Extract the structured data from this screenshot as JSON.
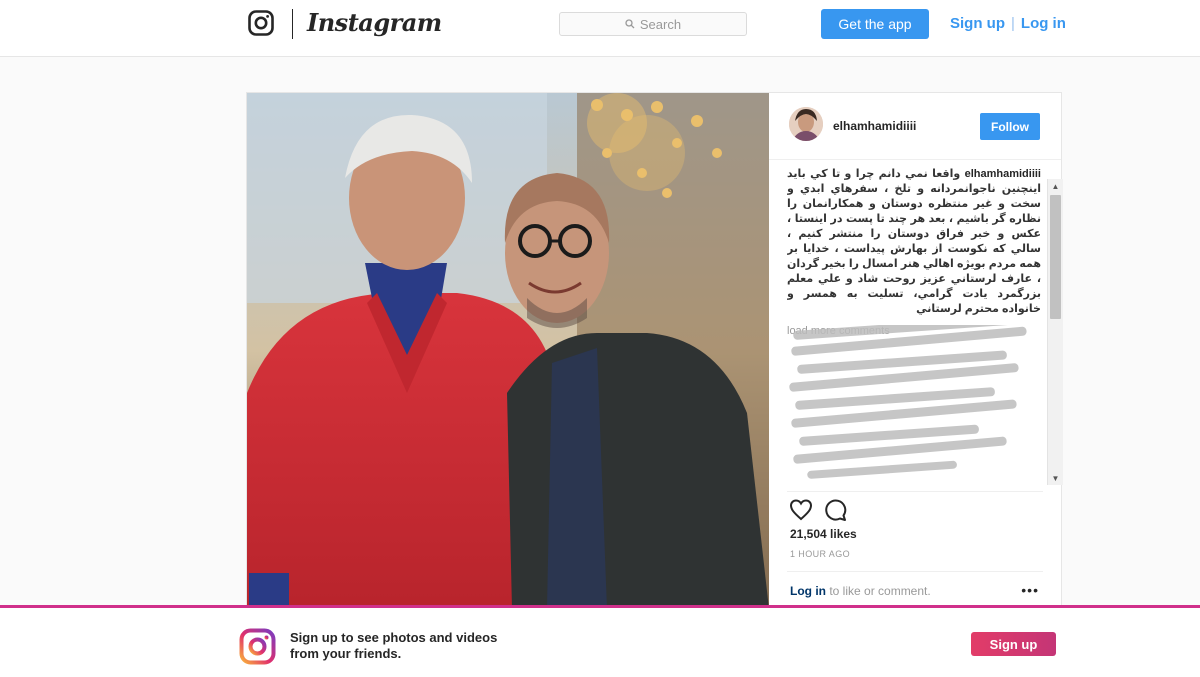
{
  "nav": {
    "wordmark": "Instagram",
    "search_placeholder": "Search",
    "get_app_label": "Get the app",
    "signup_label": "Sign up",
    "separator": "|",
    "login_label": "Log in",
    "accent_color": "#3897f0"
  },
  "post": {
    "username": "elhamhamidiiii",
    "follow_label": "Follow",
    "caption_user": "elhamhamidiiii",
    "caption_text": "واقعا نمي دانم چرا و تا كي بايد اينچنين ناجوانمردانه و تلخ ، سفرهاي ابدي و سخت و غير منتظره دوستان و همكارانمان را نظاره گر باشيم ، بعد هر چند تا پست در اينستا ، عكس و خبر فراق دوستان را منتشر كنيم ، سالي كه نكوست از بهارش پيداست ، خدايا بر همه مردم بويژه اهالي هنر امسال را بخير گردان ، عارف لرستاني عزيز روحت شاد و علي معلم بزرگمرد يادت گرامي، تسليت به همسر و خانواده محترم لرستاني",
    "load_more": "load more comments",
    "likes": "21,504 likes",
    "time": "1 HOUR AGO",
    "login_link": "Log in",
    "login_suffix": " to like or comment.",
    "more_icon": "more-horizontal-icon",
    "like_icon": "heart-icon",
    "comment_icon": "comment-icon"
  },
  "banner": {
    "text": "Sign up to see photos and videos from your friends.",
    "signup_label": "Sign up",
    "accent_color": "#d0308b"
  }
}
